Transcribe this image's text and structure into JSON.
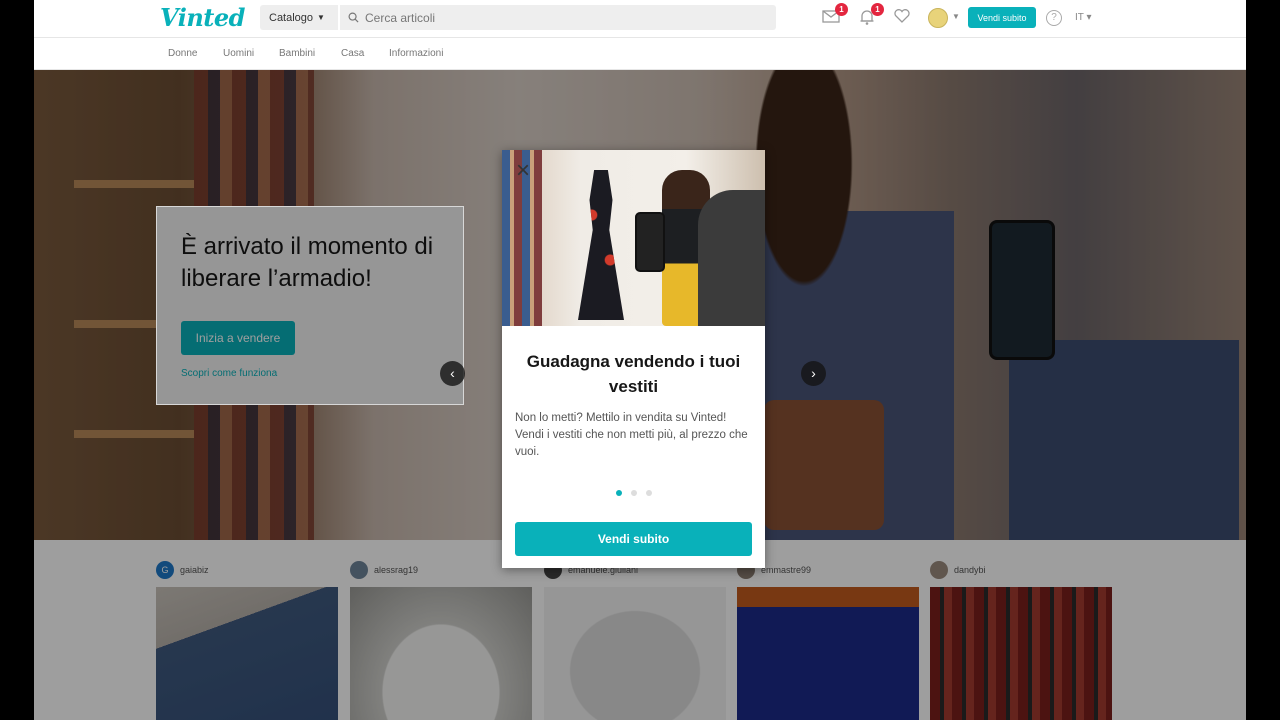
{
  "header": {
    "logo": "Vinted",
    "catalog_label": "Catalogo",
    "search_placeholder": "Cerca articoli",
    "messages_count": "1",
    "notifications_count": "1",
    "sell_label": "Vendi subito",
    "help_label": "?",
    "language": "IT"
  },
  "subnav": {
    "items": [
      "Donne",
      "Uomini",
      "Bambini",
      "Casa",
      "Informazioni"
    ]
  },
  "hero": {
    "title": "È arrivato il momento di liberare l’armadio!",
    "cta_label": "Inizia a vendere",
    "link_label": "Scopri come funziona"
  },
  "feed": {
    "items": [
      {
        "user": "gaiabiz",
        "initial": "G",
        "avatar_color": "#1d78c9"
      },
      {
        "user": "alessrag19",
        "initial": "",
        "avatar_color": "#6f8599"
      },
      {
        "user": "emanuele.giuliani",
        "initial": "",
        "avatar_color": "#444444"
      },
      {
        "user": "emmastre99",
        "initial": "",
        "avatar_color": "#8a7d72"
      },
      {
        "user": "dandybi",
        "initial": "",
        "avatar_color": "#9b8b7f"
      }
    ]
  },
  "modal": {
    "close_label": "×",
    "title": "Guadagna vendendo i tuoi vestiti",
    "text": "Non lo metti? Mettilo in vendita su Vinted! Vendi i vestiti che non metti più, al prezzo che vuoi.",
    "slide_count": 3,
    "active_slide": 1,
    "button_label": "Vendi subito"
  },
  "colors": {
    "accent": "#09b1ba",
    "badge": "#e3263f"
  }
}
